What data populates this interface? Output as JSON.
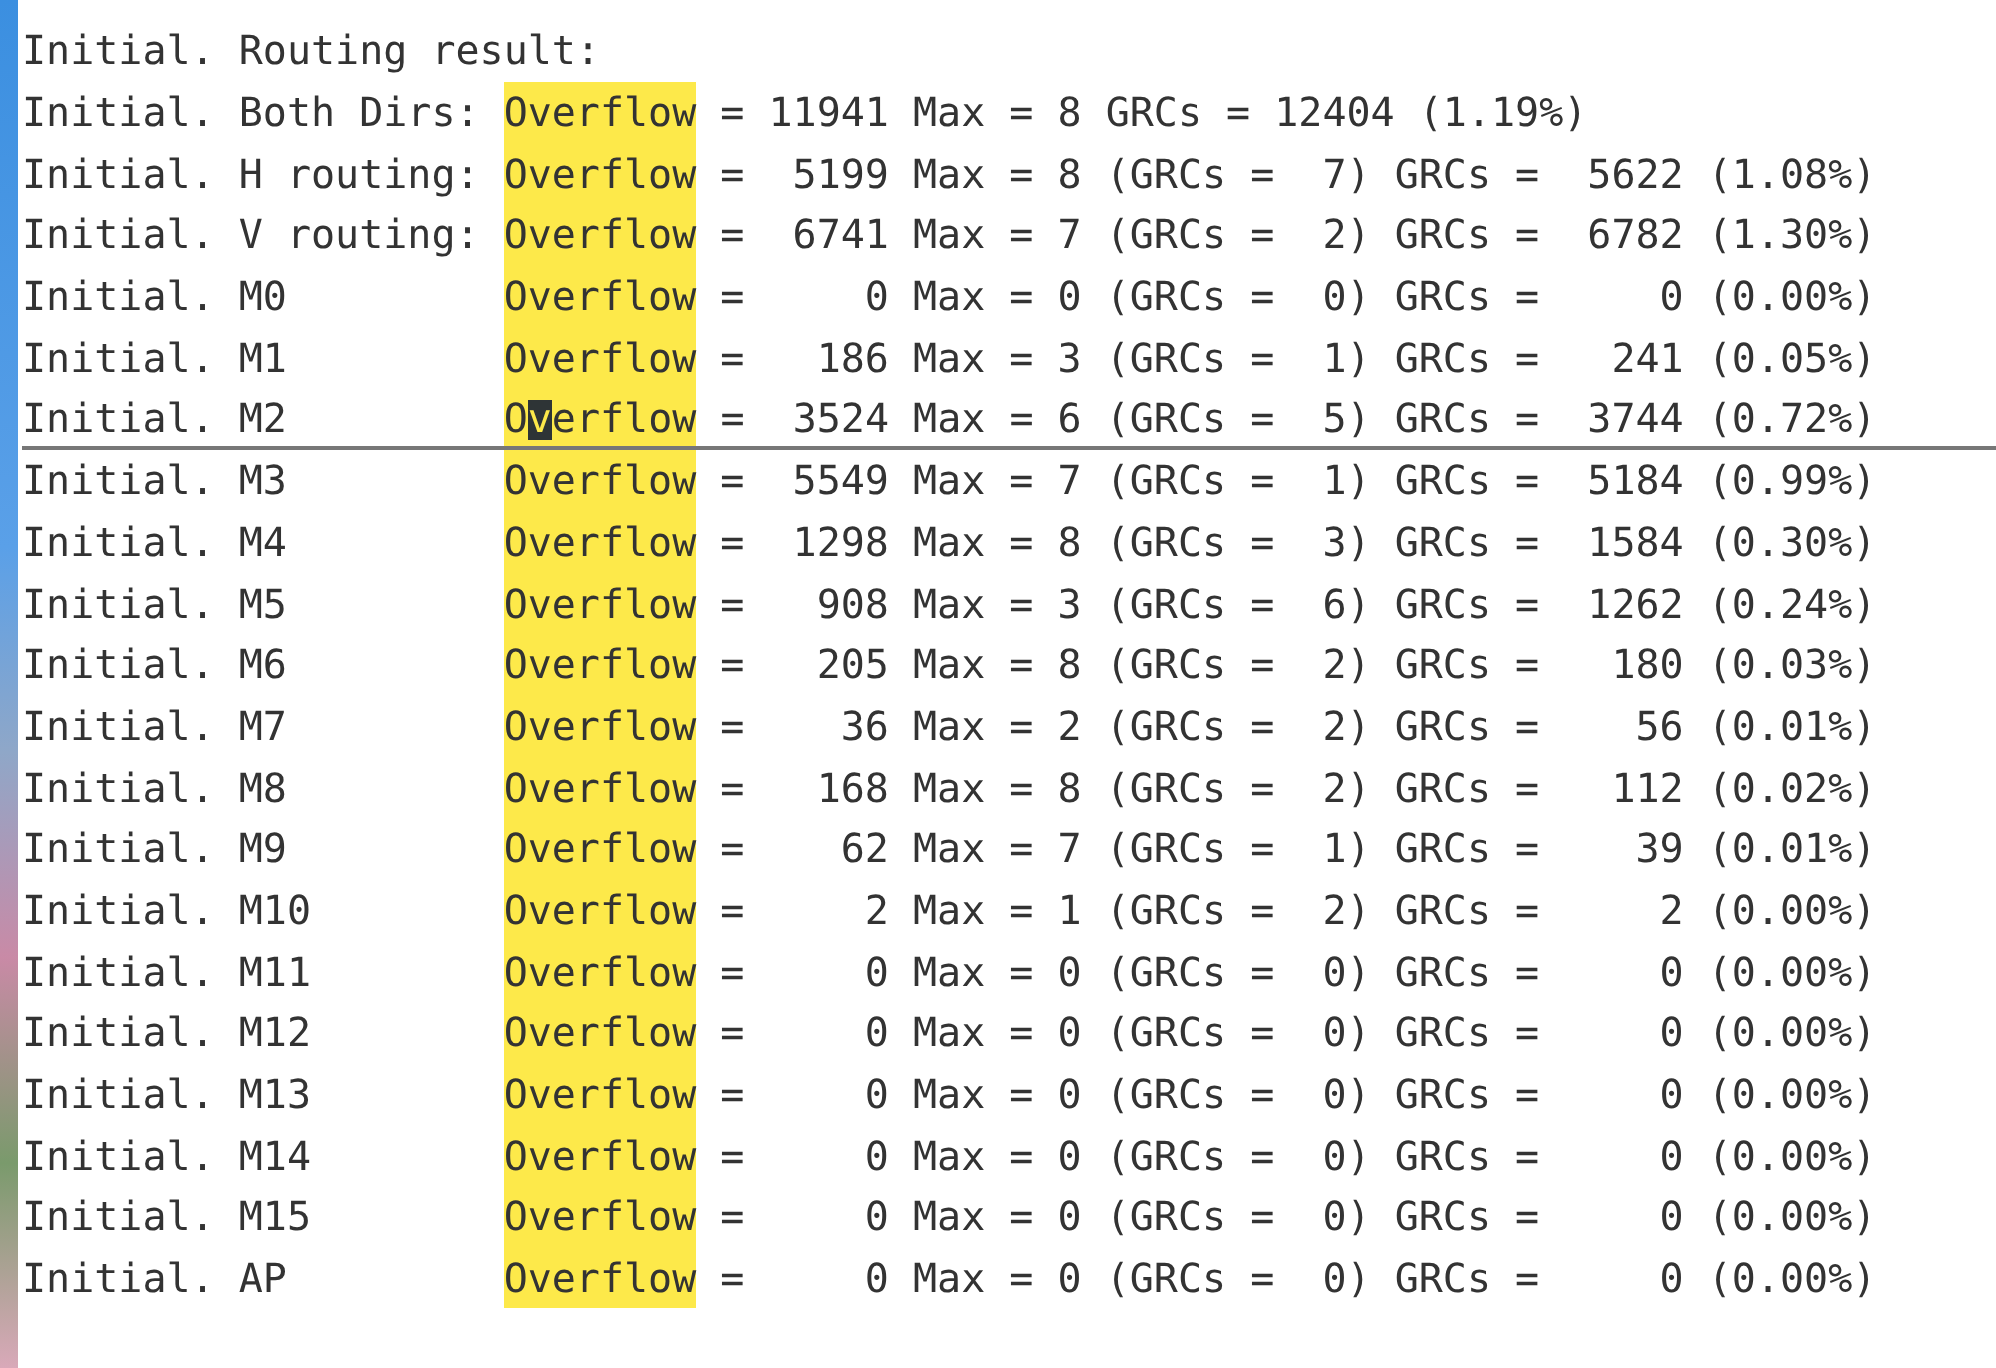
{
  "heading": "Initial. Routing result:",
  "lines": [
    {
      "label": "Initial. Both Dirs:",
      "match": "Overflow",
      "rest": " = 11941 Max = 8 GRCs = 12404 (1.19%)",
      "cursor": false
    },
    {
      "label": "Initial. H routing:",
      "match": "Overflow",
      "rest": " =  5199 Max = 8 (GRCs =  7) GRCs =  5622 (1.08%)",
      "cursor": false
    },
    {
      "label": "Initial. V routing:",
      "match": "Overflow",
      "rest": " =  6741 Max = 7 (GRCs =  2) GRCs =  6782 (1.30%)",
      "cursor": false
    },
    {
      "label": "Initial. M0",
      "match": "Overflow",
      "rest": " =     0 Max = 0 (GRCs =  0) GRCs =     0 (0.00%)",
      "cursor": false
    },
    {
      "label": "Initial. M1",
      "match": "Overflow",
      "rest": " =   186 Max = 3 (GRCs =  1) GRCs =   241 (0.05%)",
      "cursor": false
    },
    {
      "label": "Initial. M2",
      "match": "Overflow",
      "rest": " =  3524 Max = 6 (GRCs =  5) GRCs =  3744 (0.72%)",
      "cursor": true
    },
    {
      "label": "Initial. M3",
      "match": "Overflow",
      "rest": " =  5549 Max = 7 (GRCs =  1) GRCs =  5184 (0.99%)",
      "cursor": false
    },
    {
      "label": "Initial. M4",
      "match": "Overflow",
      "rest": " =  1298 Max = 8 (GRCs =  3) GRCs =  1584 (0.30%)",
      "cursor": false
    },
    {
      "label": "Initial. M5",
      "match": "Overflow",
      "rest": " =   908 Max = 3 (GRCs =  6) GRCs =  1262 (0.24%)",
      "cursor": false
    },
    {
      "label": "Initial. M6",
      "match": "Overflow",
      "rest": " =   205 Max = 8 (GRCs =  2) GRCs =   180 (0.03%)",
      "cursor": false
    },
    {
      "label": "Initial. M7",
      "match": "Overflow",
      "rest": " =    36 Max = 2 (GRCs =  2) GRCs =    56 (0.01%)",
      "cursor": false
    },
    {
      "label": "Initial. M8",
      "match": "Overflow",
      "rest": " =   168 Max = 8 (GRCs =  2) GRCs =   112 (0.02%)",
      "cursor": false
    },
    {
      "label": "Initial. M9",
      "match": "Overflow",
      "rest": " =    62 Max = 7 (GRCs =  1) GRCs =    39 (0.01%)",
      "cursor": false
    },
    {
      "label": "Initial. M10",
      "match": "Overflow",
      "rest": " =     2 Max = 1 (GRCs =  2) GRCs =     2 (0.00%)",
      "cursor": false
    },
    {
      "label": "Initial. M11",
      "match": "Overflow",
      "rest": " =     0 Max = 0 (GRCs =  0) GRCs =     0 (0.00%)",
      "cursor": false
    },
    {
      "label": "Initial. M12",
      "match": "Overflow",
      "rest": " =     0 Max = 0 (GRCs =  0) GRCs =     0 (0.00%)",
      "cursor": false
    },
    {
      "label": "Initial. M13",
      "match": "Overflow",
      "rest": " =     0 Max = 0 (GRCs =  0) GRCs =     0 (0.00%)",
      "cursor": false
    },
    {
      "label": "Initial. M14",
      "match": "Overflow",
      "rest": " =     0 Max = 0 (GRCs =  0) GRCs =     0 (0.00%)",
      "cursor": false
    },
    {
      "label": "Initial. M15",
      "match": "Overflow",
      "rest": " =     0 Max = 0 (GRCs =  0) GRCs =     0 (0.00%)",
      "cursor": false
    },
    {
      "label": "Initial. AP",
      "match": "Overflow",
      "rest": " =     0 Max = 0 (GRCs =  0) GRCs =     0 (0.00%)",
      "cursor": false
    }
  ]
}
